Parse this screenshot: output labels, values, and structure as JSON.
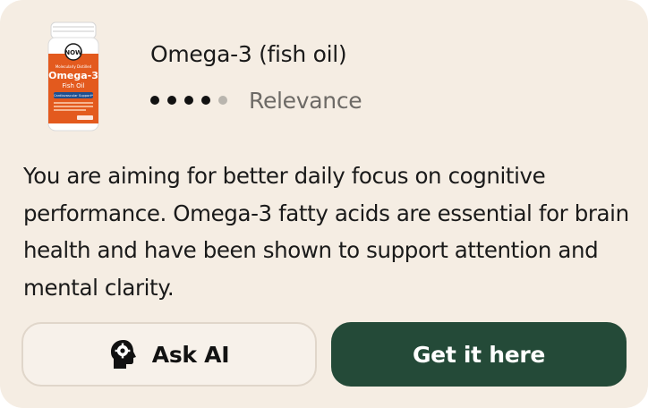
{
  "product": {
    "title": "Omega-3 (fish oil)",
    "image_label": {
      "brand": "NOW",
      "tagline": "Molecularly Distilled",
      "name": "Omega-3",
      "subname": "Fish Oil",
      "support": "Cardiovascular Support*"
    }
  },
  "rating": {
    "filled": 4,
    "total": 5,
    "label": "Relevance"
  },
  "description": "You are aiming for better daily focus on cognitive performance. Omega-3 fatty acids are essential for brain health and have been shown to support attention and mental clarity.",
  "buttons": {
    "ask_label": "Ask AI",
    "get_label": "Get it here"
  },
  "colors": {
    "card_bg": "#f5ede3",
    "primary": "#244a38",
    "label_orange": "#e35a1e"
  },
  "icons": {
    "ask": "head-gear-icon",
    "rating_dot": "dot-icon"
  }
}
